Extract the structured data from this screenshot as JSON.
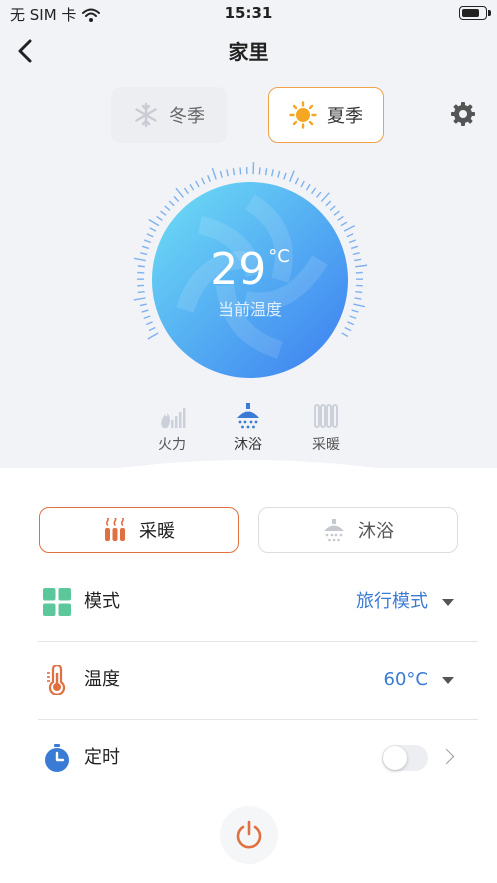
{
  "status": {
    "carrier": "无 SIM 卡",
    "time": "15:31"
  },
  "nav": {
    "title": "家里"
  },
  "seasons": {
    "winter": "冬季",
    "summer": "夏季",
    "selected": "summer"
  },
  "current": {
    "temperature": "29",
    "unit": "°C",
    "label": "当前温度"
  },
  "sources": [
    {
      "label": "火力",
      "icon": "fire-signal-icon",
      "active": false
    },
    {
      "label": "沐浴",
      "icon": "shower-icon",
      "active": true
    },
    {
      "label": "采暖",
      "icon": "radiator-icon",
      "active": false
    }
  ],
  "tabs": {
    "heating": "采暖",
    "shower": "沐浴",
    "selected": "heating"
  },
  "settings": {
    "mode": {
      "label": "模式",
      "value": "旅行模式"
    },
    "temperature": {
      "label": "温度",
      "value": "60°C"
    },
    "timer": {
      "label": "定时",
      "enabled": false
    }
  },
  "colors": {
    "accent_blue": "#3a7bd5",
    "accent_orange": "#f0a14a",
    "heat_red": "#e07040",
    "mode_green": "#5cc79a"
  }
}
